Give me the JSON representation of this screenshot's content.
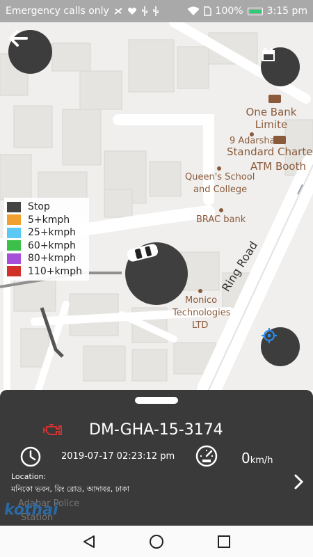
{
  "status_bar": {
    "carrier_text": "Emergency calls only",
    "battery_percent": "100%",
    "time": "3:15 pm"
  },
  "map": {
    "pois": [
      {
        "name": "One Bank Limite",
        "kind": "bank"
      },
      {
        "name": "9 Adarsha",
        "kind": "place"
      },
      {
        "name": "Standard Charte",
        "kind": "bank"
      },
      {
        "name": "ATM Booth",
        "kind": "atm"
      },
      {
        "name": "Queen's School",
        "kind": "school"
      },
      {
        "name": "and College",
        "kind": "school"
      },
      {
        "name": "BRAC bank",
        "kind": "bank"
      },
      {
        "name": "Monico",
        "kind": "company"
      },
      {
        "name": "Technologies",
        "kind": "company"
      },
      {
        "name": "LTD",
        "kind": "company"
      },
      {
        "name": "Adabar Police",
        "kind": "police"
      },
      {
        "name": "Station",
        "kind": "police"
      }
    ],
    "road_label": "Ring Road"
  },
  "legend": [
    {
      "label": "Stop",
      "color": "#444444"
    },
    {
      "label": "5+kmph",
      "color": "#f0a030"
    },
    {
      "label": "25+kmph",
      "color": "#5bc8f5"
    },
    {
      "label": "60+kmph",
      "color": "#3cc04a"
    },
    {
      "label": "80+kmph",
      "color": "#a64fd8"
    },
    {
      "label": "110+kmph",
      "color": "#d0322a"
    }
  ],
  "panel": {
    "vehicle_id": "DM-GHA-15-3174",
    "datetime": "2019-07-17 02:23:12 pm",
    "speed_value": "0",
    "speed_unit": "km/h",
    "location_label": "Location:",
    "location_value": "মনিকো ভবন, রিং রোড, আদাবর, ঢাকা",
    "watermark": "kothai"
  },
  "colors": {
    "panel_bg": "#323232",
    "button_bg": "#3d3d3d",
    "accent_blue": "#2e8de8",
    "engine_red": "#d33030"
  },
  "icons": [
    "back-arrow-icon",
    "calendar-icon",
    "car-icon",
    "locate-icon",
    "engine-icon",
    "clock-icon",
    "speedometer-icon",
    "chevron-right-icon"
  ]
}
